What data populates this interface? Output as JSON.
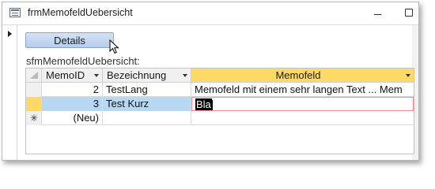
{
  "window": {
    "title": "frmMemofeldUebersicht"
  },
  "form": {
    "details_button": "Details",
    "subform_label": "sfmMemofeldUebersicht:"
  },
  "table": {
    "columns": [
      "MemoID",
      "Bezeichnung",
      "Memofeld"
    ],
    "rows": [
      {
        "memo_id": "2",
        "bezeichnung": "TestLang",
        "memofeld": "Memofeld mit einem sehr langen Text ... Mem"
      },
      {
        "memo_id": "3",
        "bezeichnung": "Test Kurz",
        "memofeld": "Bla"
      }
    ],
    "new_row": {
      "memo_id": "(Neu)",
      "marker": "✳"
    }
  },
  "colors": {
    "active_header": "#ffd966",
    "selected_row": "#b8d7f0",
    "button": "#c6d8f0"
  }
}
